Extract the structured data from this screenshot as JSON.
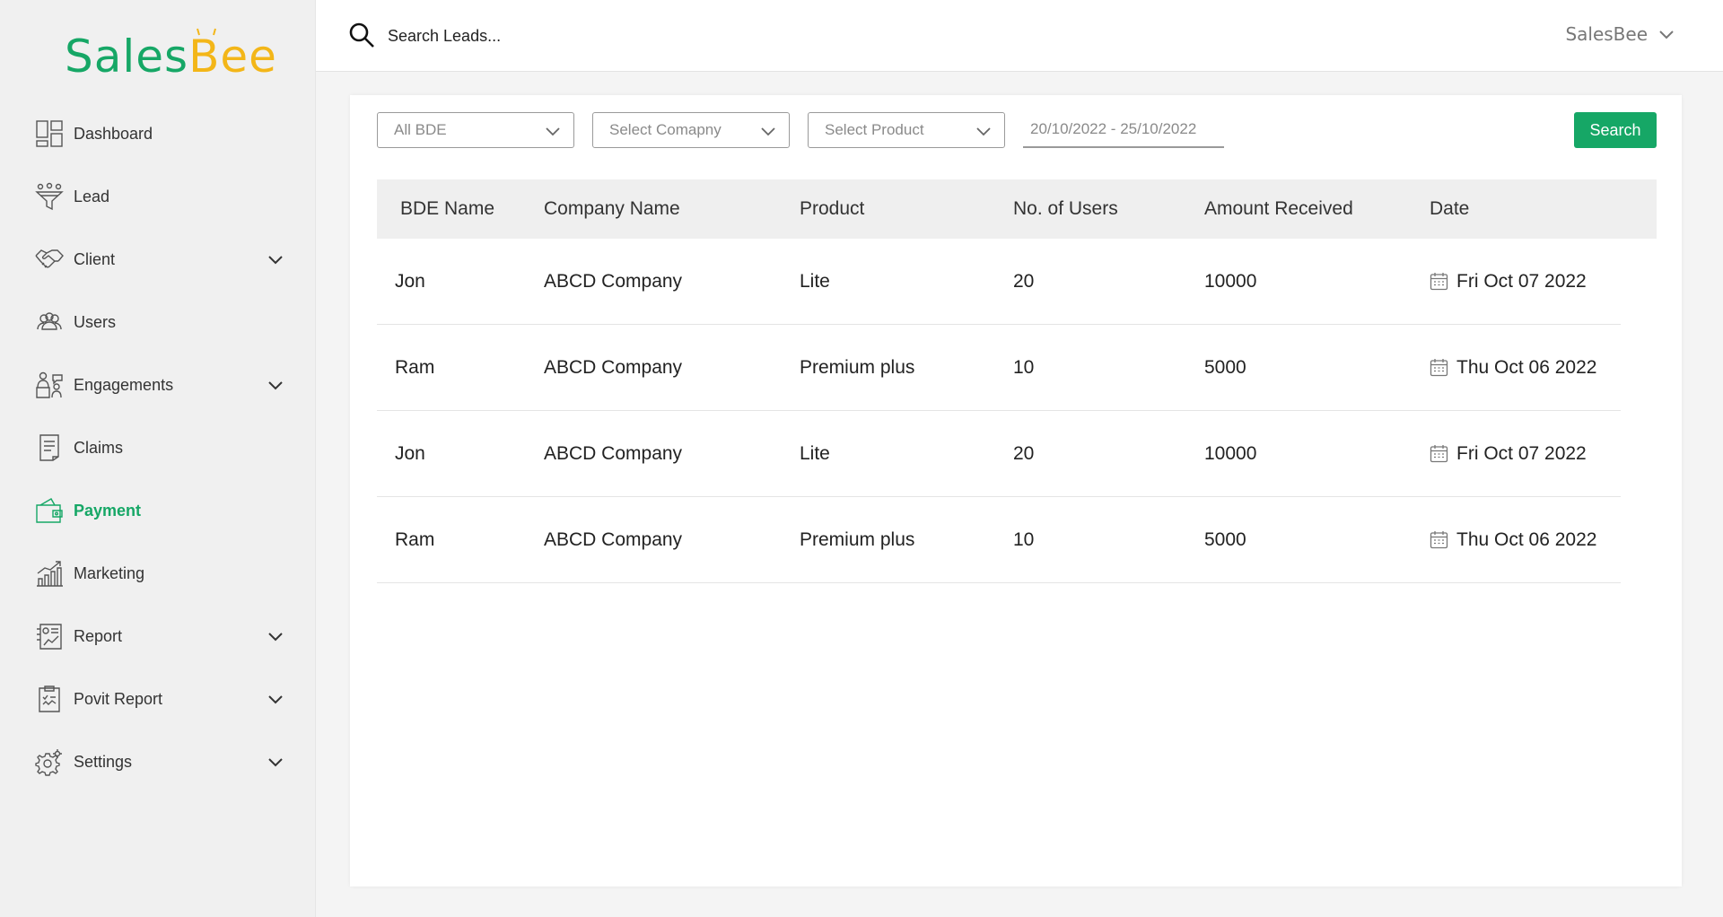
{
  "app": {
    "logo_part1": "Sales",
    "logo_part2": "Bee",
    "logo_colors": {
      "green": "#16a766",
      "yellow": "#f3b618"
    }
  },
  "sidebar": {
    "items": [
      {
        "label": "Dashboard",
        "icon": "dashboard-icon",
        "has_submenu": false,
        "active": false
      },
      {
        "label": "Lead",
        "icon": "funnel-icon",
        "has_submenu": false,
        "active": false
      },
      {
        "label": "Client",
        "icon": "handshake-icon",
        "has_submenu": true,
        "active": false
      },
      {
        "label": "Users",
        "icon": "users-icon",
        "has_submenu": false,
        "active": false
      },
      {
        "label": "Engagements",
        "icon": "engagement-icon",
        "has_submenu": true,
        "active": false
      },
      {
        "label": "Claims",
        "icon": "document-icon",
        "has_submenu": false,
        "active": false
      },
      {
        "label": "Payment",
        "icon": "wallet-icon",
        "has_submenu": false,
        "active": true
      },
      {
        "label": "Marketing",
        "icon": "growth-chart-icon",
        "has_submenu": false,
        "active": false
      },
      {
        "label": "Report",
        "icon": "report-icon",
        "has_submenu": true,
        "active": false
      },
      {
        "label": "Povit Report",
        "icon": "clipboard-icon",
        "has_submenu": true,
        "active": false
      },
      {
        "label": "Settings",
        "icon": "gear-icon",
        "has_submenu": true,
        "active": false
      }
    ]
  },
  "header": {
    "search_placeholder": "Search Leads...",
    "user_menu_label": "SalesBee"
  },
  "filters": {
    "bde": "All BDE",
    "company": "Select Comapny",
    "product": "Select Product",
    "date_range": "20/10/2022 - 25/10/2022",
    "search_label": "Search"
  },
  "table": {
    "headers": [
      "BDE Name",
      "Company Name",
      "Product",
      "No. of Users",
      "Amount Received",
      "Date"
    ],
    "rows": [
      [
        "Jon",
        "ABCD Company",
        "Lite",
        "20",
        "10000",
        "Fri Oct 07 2022"
      ],
      [
        "Ram",
        "ABCD Company",
        "Premium plus",
        "10",
        "5000",
        "Thu Oct 06 2022"
      ],
      [
        "Jon",
        "ABCD Company",
        "Lite",
        "20",
        "10000",
        "Fri Oct 07 2022"
      ],
      [
        "Ram",
        "ABCD Company",
        "Premium plus",
        "10",
        "5000",
        "Thu Oct 06 2022"
      ]
    ]
  },
  "colors": {
    "accent": "#16a766",
    "sidebar_bg": "#f0f0f0",
    "table_header_bg": "#efefef"
  }
}
